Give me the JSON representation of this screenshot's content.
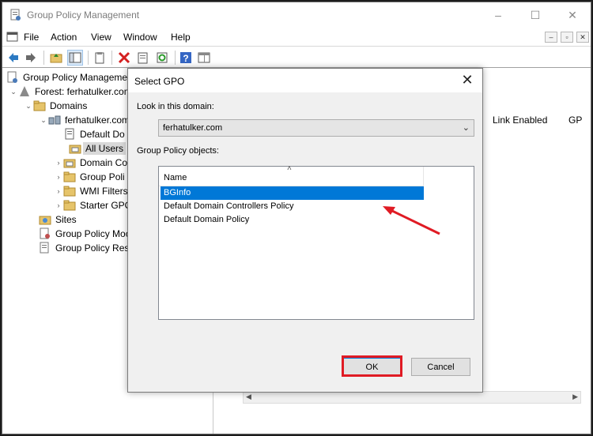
{
  "window": {
    "title": "Group Policy Management",
    "controls": {
      "minimize": "–",
      "maximize": "☐",
      "close": "✕"
    }
  },
  "menu": {
    "items": [
      "File",
      "Action",
      "View",
      "Window",
      "Help"
    ]
  },
  "mdi_controls": {
    "minimize": "–",
    "restore": "▫",
    "close": "✕"
  },
  "toolbar": {
    "buttons": [
      "back-icon",
      "forward-icon",
      "up-folder-icon",
      "show-tree-icon",
      "properties-icon",
      "delete-icon",
      "export-icon",
      "refresh-icon",
      "help-icon",
      "console-view-icon"
    ]
  },
  "tree": {
    "items": [
      {
        "label": "Group Policy Manageme",
        "expander": "",
        "icon": "gpm-icon"
      },
      {
        "label": "Forest: ferhatulker.com",
        "expander": "⌄",
        "icon": "forest-icon"
      },
      {
        "label": "Domains",
        "expander": "⌄",
        "icon": "folder-icon"
      },
      {
        "label": "ferhatulker.com",
        "expander": "⌄",
        "icon": "domain-icon"
      },
      {
        "label": "Default Do",
        "expander": "",
        "icon": "gpo-link-icon"
      },
      {
        "label": "All Users",
        "expander": "",
        "icon": "ou-icon"
      },
      {
        "label": "Domain Co",
        "expander": "›",
        "icon": "ou-icon"
      },
      {
        "label": "Group Poli",
        "expander": "›",
        "icon": "folder-icon"
      },
      {
        "label": "WMI Filters",
        "expander": "›",
        "icon": "folder-icon"
      },
      {
        "label": "Starter GPO",
        "expander": "›",
        "icon": "folder-icon"
      },
      {
        "label": "Sites",
        "expander": "",
        "icon": "sites-icon"
      },
      {
        "label": "Group Policy Moc",
        "expander": "",
        "icon": "modeling-icon"
      },
      {
        "label": "Group Policy Resu",
        "expander": "",
        "icon": "results-icon"
      }
    ]
  },
  "right_pane": {
    "columns": [
      "Link Enabled",
      "GP"
    ]
  },
  "dialog": {
    "title": "Select GPO",
    "close": "✕",
    "domain_label": "Look in this domain:",
    "domain_value": "ferhatulker.com",
    "combo_arrow": "⌄",
    "objects_label": "Group Policy objects:",
    "column_name": "Name",
    "sort_indicator": "˄",
    "items": [
      "BGInfo",
      "Default Domain Controllers Policy",
      "Default Domain Policy"
    ],
    "selected_item": "BGInfo",
    "ok_label": "OK",
    "cancel_label": "Cancel"
  },
  "colors": {
    "selection": "#0078d7",
    "annotation": "#e01b24"
  }
}
